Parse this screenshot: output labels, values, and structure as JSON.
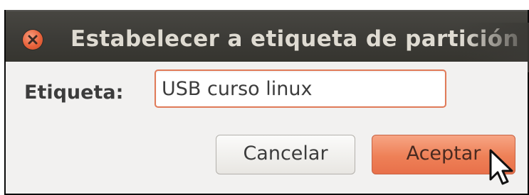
{
  "window": {
    "title": "Estabelecer a etiqueta de partición",
    "close_icon": "close-icon"
  },
  "form": {
    "label": "Etiqueta:",
    "input_value": "USB curso linux"
  },
  "buttons": {
    "cancel_label": "Cancelar",
    "accept_label": "Aceptar"
  },
  "colors": {
    "titlebar": "#3b3a36",
    "title_text": "#dfdbd2",
    "accent": "#ee8057",
    "dialog_bg": "#f2f1f0"
  },
  "pointer": "arrow-cursor-icon"
}
